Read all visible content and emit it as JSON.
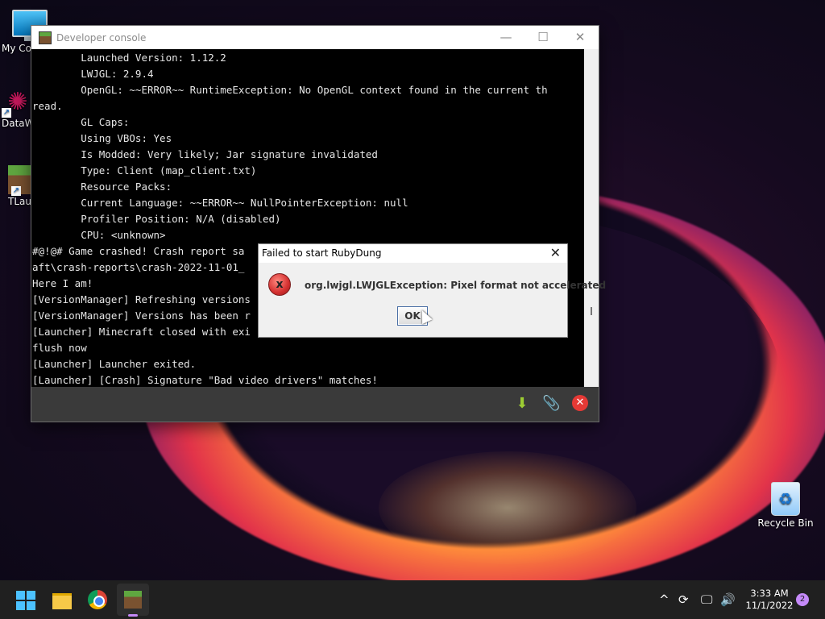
{
  "desktop": {
    "icons": [
      {
        "label": "My Co",
        "icon": "monitor-icon"
      },
      {
        "label": "DataW",
        "icon": "datawrap-icon"
      },
      {
        "label": "TLaun",
        "icon": "tlauncher-icon"
      },
      {
        "label": "Recycle Bin",
        "icon": "recycle-bin-icon"
      }
    ]
  },
  "console_window": {
    "title": "Developer console",
    "controls": {
      "minimize": "—",
      "maximize": "☐",
      "close": "✕"
    },
    "lines": [
      "        Launched Version: 1.12.2",
      "        LWJGL: 2.9.4",
      "        OpenGL: ~~ERROR~~ RuntimeException: No OpenGL context found in the current th",
      "read.",
      "        GL Caps:",
      "        Using VBOs: Yes",
      "        Is Modded: Very likely; Jar signature invalidated",
      "        Type: Client (map_client.txt)",
      "        Resource Packs:",
      "        Current Language: ~~ERROR~~ NullPointerException: null",
      "        Profiler Position: N/A (disabled)",
      "        CPU: <unknown>",
      "#@!@# Game crashed! Crash report sa                                          cr",
      "aft\\crash-reports\\crash-2022-11-01_",
      "Here I am!",
      "[VersionManager] Refreshing versions",
      "[VersionManager] Versions has been r",
      "[Launcher] Minecraft closed with exi",
      "flush now",
      "[Launcher] Launcher exited.",
      "[Launcher] [Crash] Signature \"Bad video drivers\" matches!"
    ],
    "toolbar": {
      "download": "download-icon",
      "attach": "paperclip-icon",
      "close": "close-icon"
    }
  },
  "dialog": {
    "title": "Failed to start RubyDung",
    "message": "org.lwjgl.LWJGLException: Pixel format not accelerated",
    "ok_label": "OK",
    "icon_glyph": "x"
  },
  "taskbar": {
    "apps": [
      "start-icon",
      "file-explorer-icon",
      "chrome-icon",
      "minecraft-icon"
    ],
    "tray": {
      "chevron": "^"
    },
    "clock": {
      "time": "3:33 AM",
      "date": "11/1/2022"
    },
    "notifications": "2"
  }
}
